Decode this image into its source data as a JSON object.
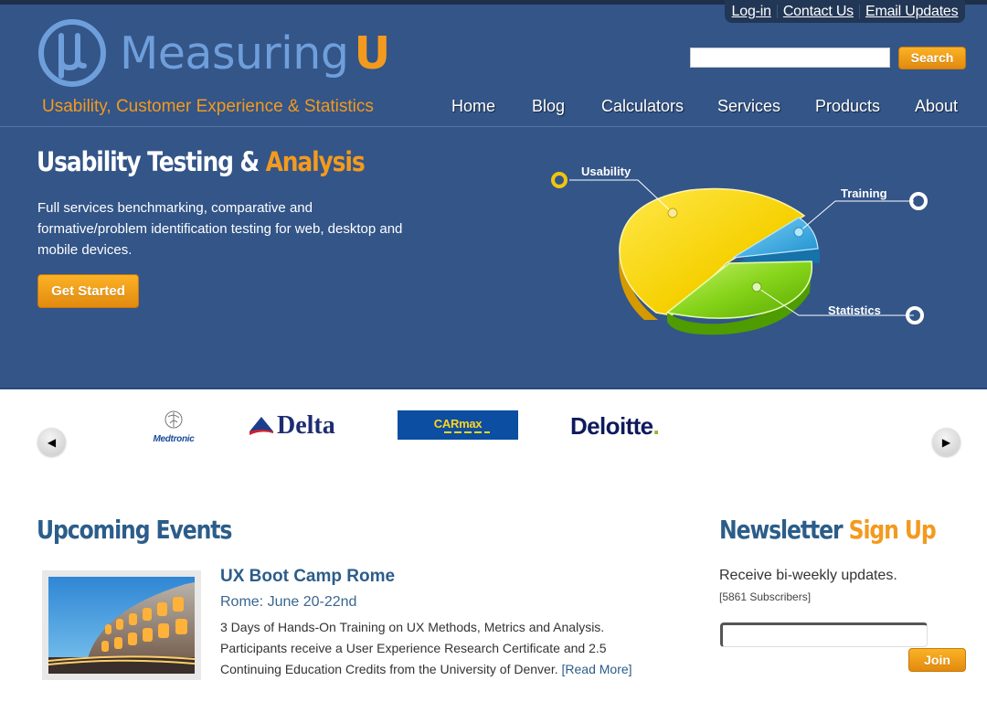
{
  "brand": {
    "name": "Measuring",
    "name_accent": "U",
    "logo_symbol": "μ",
    "tagline": "Usability, Customer Experience & Statistics",
    "colors": {
      "primary": "#335588",
      "accent": "#f39a1e",
      "logo_blue": "#6f9fdb",
      "heading": "#2c5d8a"
    }
  },
  "utility_links": [
    {
      "label": "Log-in"
    },
    {
      "label": "Contact Us"
    },
    {
      "label": "Email Updates"
    }
  ],
  "search": {
    "value": "",
    "placeholder": "",
    "button_label": "Search"
  },
  "nav": [
    {
      "label": "Home"
    },
    {
      "label": "Blog"
    },
    {
      "label": "Calculators"
    },
    {
      "label": "Services"
    },
    {
      "label": "Products"
    },
    {
      "label": "About"
    }
  ],
  "hero": {
    "title": "Usability Testing &",
    "title_accent": "Analysis",
    "description": "Full services benchmarking, comparative and formative/problem identification testing for web, desktop and mobile devices.",
    "cta_label": "Get Started",
    "illustration": {
      "labels": [
        "Usability",
        "Training",
        "Statistics"
      ],
      "colors": [
        "#f5d000",
        "#2aa3dc",
        "#7acc12"
      ]
    }
  },
  "clients": {
    "prev_icon": "arrow-left-icon",
    "next_icon": "arrow-right-icon",
    "logos": [
      {
        "name": "Medtronic"
      },
      {
        "name": "Delta"
      },
      {
        "name": "CARMAX",
        "name_part1": "CAR",
        "name_part2": "max"
      },
      {
        "name": "Deloitte",
        "suffix": "."
      }
    ]
  },
  "events": {
    "heading": "Upcoming Events",
    "items": [
      {
        "title": "UX Boot Camp Rome",
        "date": "Rome: June 20-22nd",
        "description": "3 Days of Hands-On Training on UX Methods, Metrics and Analysis. Participants receive a User Experience Research Certificate and 2.5 Continuing Education Credits from the University of Denver.",
        "read_more": "[Read More]",
        "image_alt": "Colosseum at dusk"
      }
    ]
  },
  "newsletter": {
    "heading": "Newsletter",
    "heading_accent": "Sign Up",
    "text": "Receive bi-weekly updates.",
    "subscribers": "[5861 Subscribers]",
    "email_value": "",
    "email_placeholder": "",
    "button_label": "Join"
  }
}
